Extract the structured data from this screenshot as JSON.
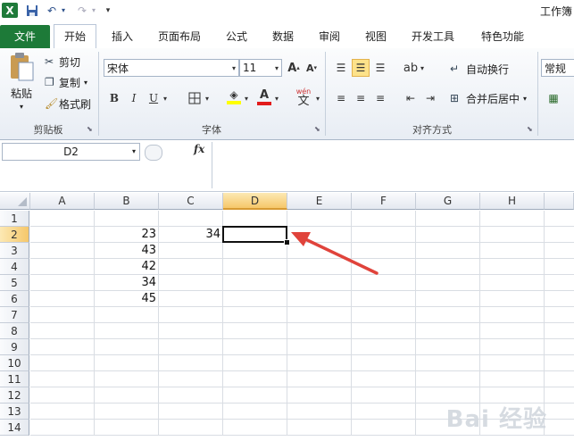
{
  "window": {
    "title": "工作簿"
  },
  "tabs": [
    "文件",
    "开始",
    "插入",
    "页面布局",
    "公式",
    "数据",
    "审阅",
    "视图",
    "开发工具",
    "特色功能"
  ],
  "clipboard": {
    "paste": "粘贴",
    "cut": "剪切",
    "copy": "复制",
    "format_painter": "格式刷",
    "label": "剪贴板"
  },
  "font": {
    "name": "宋体",
    "size": "11",
    "label": "字体",
    "bold": "B",
    "italic": "I",
    "underline": "U",
    "phonetic_top": "wén",
    "phonetic_bottom": "文"
  },
  "alignment": {
    "wrap_text": "自动换行",
    "merge_center": "合并后居中",
    "label": "对齐方式"
  },
  "number": {
    "format": "常规"
  },
  "formula_bar": {
    "name_box": "D2",
    "fx": "fx",
    "value": ""
  },
  "columns": [
    "A",
    "B",
    "C",
    "D",
    "E",
    "F",
    "G",
    "H"
  ],
  "active_column": "D",
  "active_row": "2",
  "rows": [
    "1",
    "2",
    "3",
    "4",
    "5",
    "6",
    "7",
    "8",
    "9",
    "10",
    "11",
    "12",
    "13",
    "14"
  ],
  "cells": [
    {
      "ref": "B2",
      "value": "23"
    },
    {
      "ref": "C2",
      "value": "34"
    },
    {
      "ref": "B3",
      "value": "43"
    },
    {
      "ref": "B4",
      "value": "42"
    },
    {
      "ref": "B5",
      "value": "34"
    },
    {
      "ref": "B6",
      "value": "45"
    }
  ],
  "watermark": "Bai 经验",
  "colors": {
    "file_tab": "#1d7a38",
    "arrow": "#e0433b",
    "active_header": "#f6c76a"
  }
}
